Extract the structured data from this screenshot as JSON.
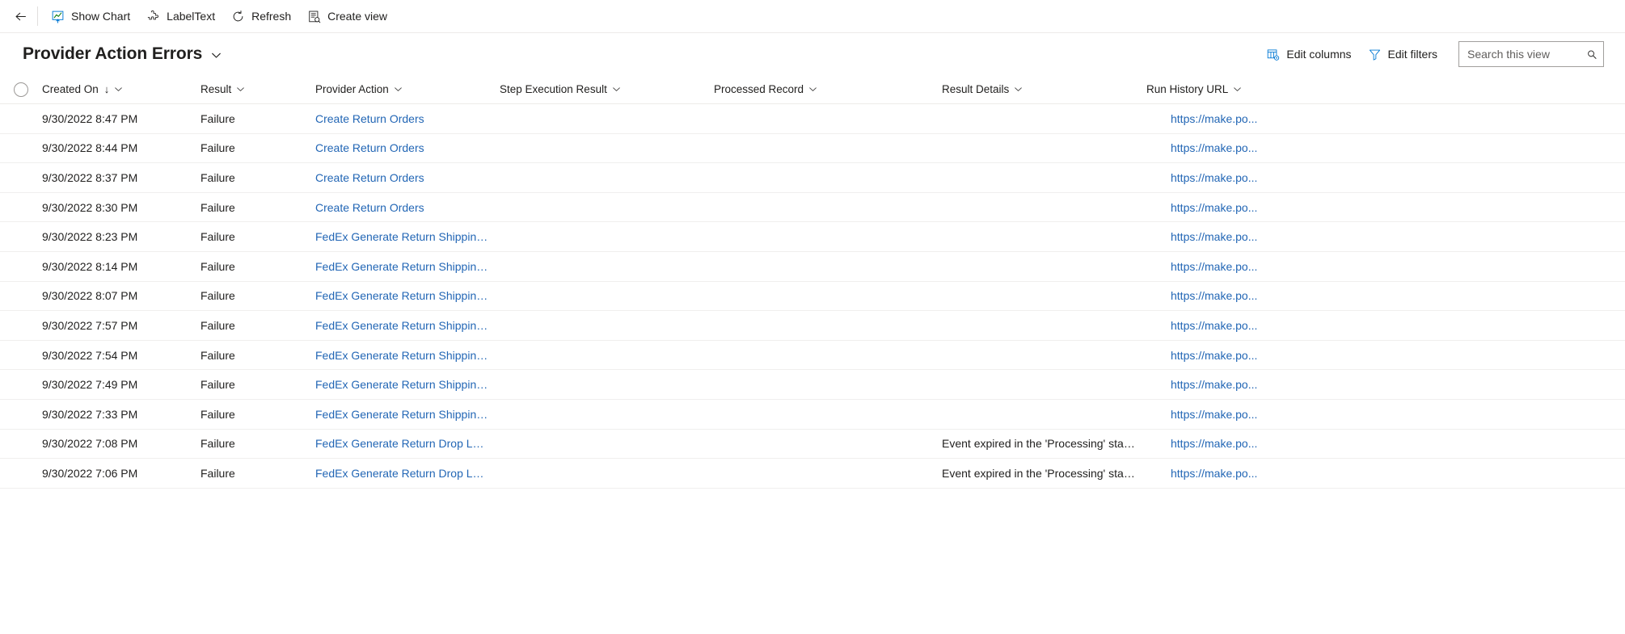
{
  "commandbar": {
    "back_label": "Back",
    "items": [
      {
        "label": "Show Chart",
        "icon": "show-chart-icon"
      },
      {
        "label": "LabelText",
        "icon": "puzzle-piece-icon"
      },
      {
        "label": "Refresh",
        "icon": "refresh-icon"
      },
      {
        "label": "Create view",
        "icon": "create-view-icon"
      }
    ]
  },
  "header": {
    "title": "Provider Action Errors",
    "edit_columns_label": "Edit columns",
    "edit_filters_label": "Edit filters",
    "search_placeholder": "Search this view",
    "search_value": ""
  },
  "grid": {
    "columns": [
      {
        "key": "created_on",
        "label": "Created On",
        "sorted": true,
        "sort_dir": "↓"
      },
      {
        "key": "result",
        "label": "Result",
        "sorted": false
      },
      {
        "key": "provider_action",
        "label": "Provider Action",
        "sorted": false
      },
      {
        "key": "step_execution_result",
        "label": "Step Execution Result",
        "sorted": false
      },
      {
        "key": "processed_record",
        "label": "Processed Record",
        "sorted": false
      },
      {
        "key": "result_details",
        "label": "Result Details",
        "sorted": false
      },
      {
        "key": "run_history_url",
        "label": "Run History URL",
        "sorted": false
      }
    ],
    "rows": [
      {
        "created_on": "9/30/2022 8:47 PM",
        "result": "Failure",
        "provider_action": "Create Return Orders",
        "step_execution_result": "",
        "processed_record": "",
        "result_details": "",
        "run_history_url": "https://make.po..."
      },
      {
        "created_on": "9/30/2022 8:44 PM",
        "result": "Failure",
        "provider_action": "Create Return Orders",
        "step_execution_result": "",
        "processed_record": "",
        "result_details": "",
        "run_history_url": "https://make.po..."
      },
      {
        "created_on": "9/30/2022 8:37 PM",
        "result": "Failure",
        "provider_action": "Create Return Orders",
        "step_execution_result": "",
        "processed_record": "",
        "result_details": "",
        "run_history_url": "https://make.po..."
      },
      {
        "created_on": "9/30/2022 8:30 PM",
        "result": "Failure",
        "provider_action": "Create Return Orders",
        "step_execution_result": "",
        "processed_record": "",
        "result_details": "",
        "run_history_url": "https://make.po..."
      },
      {
        "created_on": "9/30/2022 8:23 PM",
        "result": "Failure",
        "provider_action": "FedEx Generate Return Shipping La...",
        "step_execution_result": "",
        "processed_record": "",
        "result_details": "",
        "run_history_url": "https://make.po..."
      },
      {
        "created_on": "9/30/2022 8:14 PM",
        "result": "Failure",
        "provider_action": "FedEx Generate Return Shipping La...",
        "step_execution_result": "",
        "processed_record": "",
        "result_details": "",
        "run_history_url": "https://make.po..."
      },
      {
        "created_on": "9/30/2022 8:07 PM",
        "result": "Failure",
        "provider_action": "FedEx Generate Return Shipping La...",
        "step_execution_result": "",
        "processed_record": "",
        "result_details": "",
        "run_history_url": "https://make.po..."
      },
      {
        "created_on": "9/30/2022 7:57 PM",
        "result": "Failure",
        "provider_action": "FedEx Generate Return Shipping La...",
        "step_execution_result": "",
        "processed_record": "",
        "result_details": "",
        "run_history_url": "https://make.po..."
      },
      {
        "created_on": "9/30/2022 7:54 PM",
        "result": "Failure",
        "provider_action": "FedEx Generate Return Shipping La...",
        "step_execution_result": "",
        "processed_record": "",
        "result_details": "",
        "run_history_url": "https://make.po..."
      },
      {
        "created_on": "9/30/2022 7:49 PM",
        "result": "Failure",
        "provider_action": "FedEx Generate Return Shipping La...",
        "step_execution_result": "",
        "processed_record": "",
        "result_details": "",
        "run_history_url": "https://make.po..."
      },
      {
        "created_on": "9/30/2022 7:33 PM",
        "result": "Failure",
        "provider_action": "FedEx Generate Return Shipping La...",
        "step_execution_result": "",
        "processed_record": "",
        "result_details": "",
        "run_history_url": "https://make.po..."
      },
      {
        "created_on": "9/30/2022 7:08 PM",
        "result": "Failure",
        "provider_action": "FedEx Generate Return Drop Locati...",
        "step_execution_result": "",
        "processed_record": "",
        "result_details": "Event expired in the 'Processing' state.",
        "run_history_url": "https://make.po..."
      },
      {
        "created_on": "9/30/2022 7:06 PM",
        "result": "Failure",
        "provider_action": "FedEx Generate Return Drop Locati...",
        "step_execution_result": "",
        "processed_record": "",
        "result_details": "Event expired in the 'Processing' state.",
        "run_history_url": "https://make.po..."
      }
    ]
  },
  "colors": {
    "link": "#2266b5",
    "text": "#201f1e",
    "border": "#edebe9",
    "accent": "#0078d4"
  }
}
